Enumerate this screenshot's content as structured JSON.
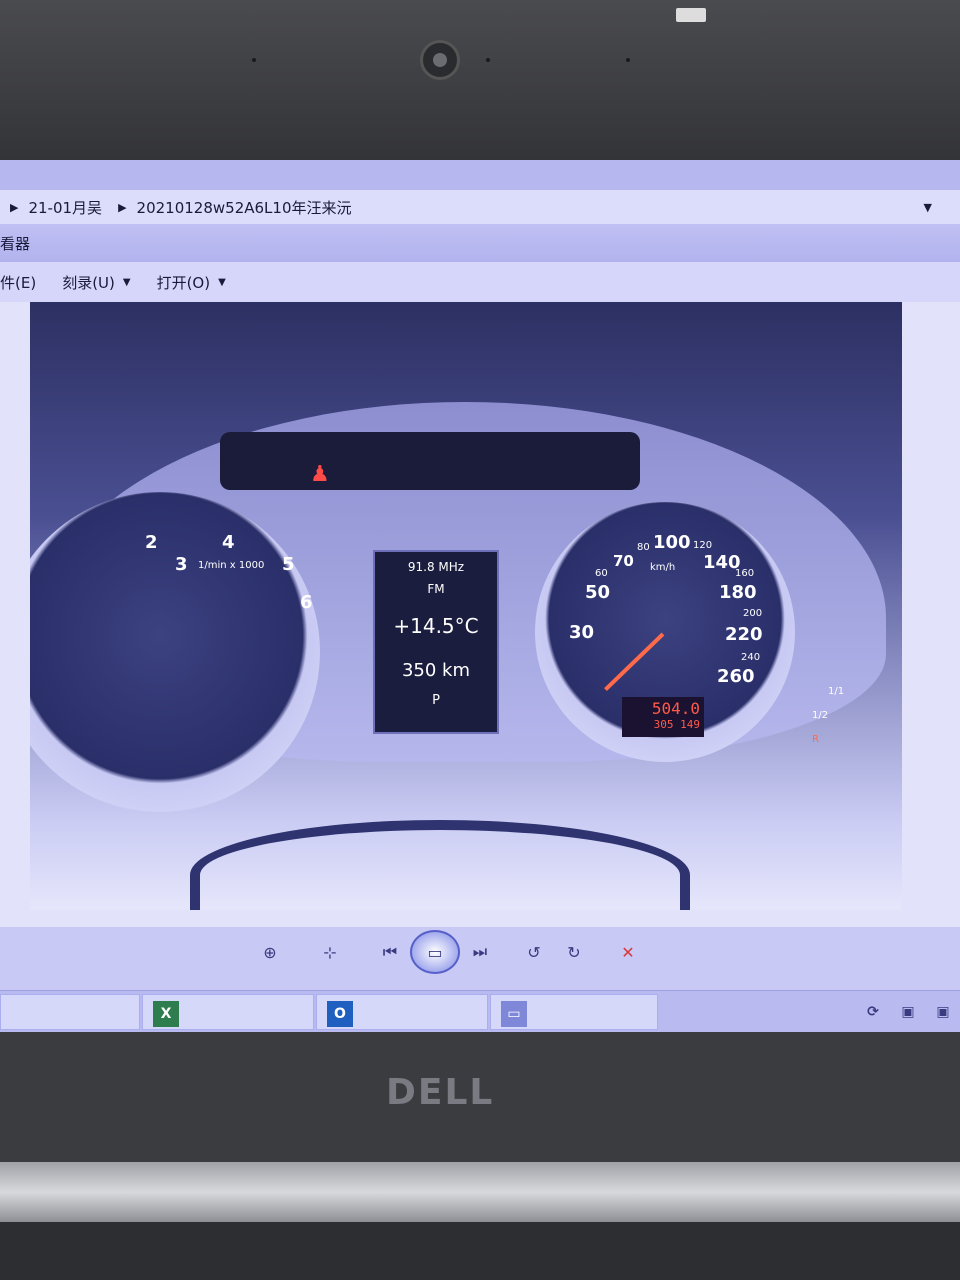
{
  "explorer": {
    "breadcrumb": [
      "21-01月吴",
      "20210128w52A6L10年汪来沅"
    ]
  },
  "viewer": {
    "title_suffix": "看器",
    "menu": [
      {
        "label": "件(E)",
        "has_dropdown": false
      },
      {
        "label": "刻录(U)",
        "has_dropdown": true
      },
      {
        "label": "打开(O)",
        "has_dropdown": true
      }
    ]
  },
  "dashboard": {
    "tach_numbers": [
      "2",
      "3",
      "4",
      "5",
      "6"
    ],
    "tach_unit": "1/min x 1000",
    "speed_numbers": [
      "30",
      "50",
      "60",
      "70",
      "80",
      "100",
      "120",
      "140",
      "160",
      "180",
      "200",
      "220",
      "240",
      "260"
    ],
    "speed_unit": "km/h",
    "display": {
      "radio_freq": "91.8 MHz",
      "radio_band": "FM",
      "temperature": "+14.5°C",
      "range": "350 km",
      "gear": "P"
    },
    "trip": "504.0",
    "odometer": "305 149",
    "fuel_marks": [
      "1/1",
      "1/2",
      "R"
    ]
  },
  "toolbar": {
    "buttons": [
      "zoom-icon",
      "fit-icon",
      "previous-icon",
      "slideshow-icon",
      "next-icon",
      "rotate-left-icon",
      "rotate-right-icon",
      "delete-icon"
    ]
  },
  "brand": "DELL",
  "colors": {
    "screen_tint": "#c9c9f6",
    "needle": "#ff6a4a",
    "odo": "#ff5a4a"
  }
}
